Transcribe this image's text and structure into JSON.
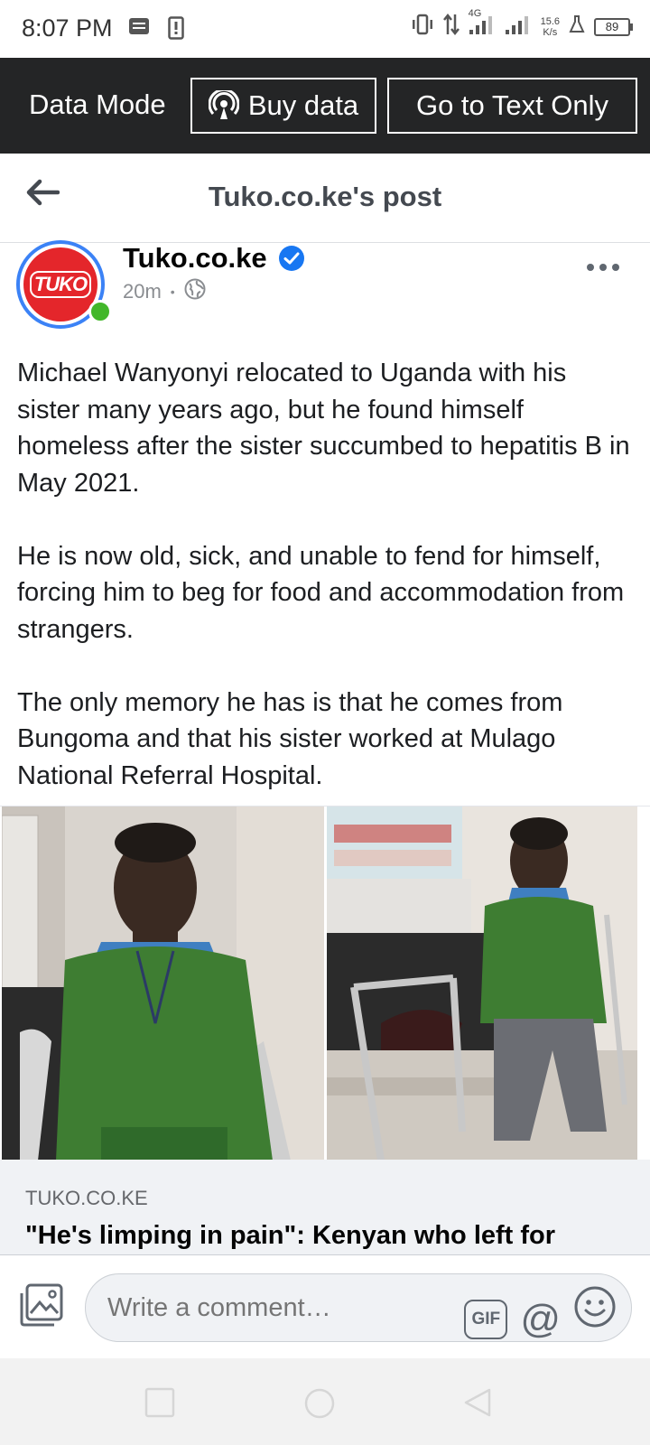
{
  "status_bar": {
    "time": "8:07 PM",
    "network": "4G",
    "speed_value": "15.6",
    "speed_unit": "K/s",
    "battery": "89"
  },
  "data_bar": {
    "mode_label": "Data Mode",
    "buy_label": "Buy data",
    "text_only_label": "Go to Text Only"
  },
  "header": {
    "title": "Tuko.co.ke's post"
  },
  "post": {
    "avatar_text": "TUKO",
    "page_name": "Tuko.co.ke",
    "time": "20m",
    "paragraphs": [
      "Michael Wanyonyi relocated to Uganda with his sister many years ago, but he found himself homeless after the sister succumbed to hepatitis B in May 2021.",
      "He is now old, sick, and unable to fend for himself, forcing him to beg for food and accommodation from strangers.",
      "The only memory he has is that he comes from Bungoma and that his sister worked at Mulago National Referral Hospital."
    ]
  },
  "link_preview": {
    "domain": "TUKO.CO.KE",
    "title": "\"He's limping in pain\": Kenyan who left for"
  },
  "comment_bar": {
    "placeholder": "Write a comment…",
    "gif_label": "GIF",
    "mention_label": "@"
  },
  "colors": {
    "data_bar_bg": "#242526",
    "brand_red": "#e4262b",
    "verified_blue": "#1877f2",
    "online_green": "#42b72a"
  }
}
